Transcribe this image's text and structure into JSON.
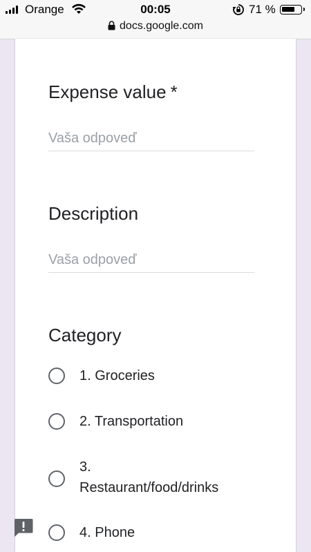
{
  "status_bar": {
    "carrier": "Orange",
    "time": "00:05",
    "battery": "71 %",
    "battery_level": 0.71,
    "url": "docs.google.com"
  },
  "form": {
    "questions": [
      {
        "title": "Expense value",
        "required_mark": "*",
        "placeholder": "Vaša odpoveď"
      },
      {
        "title": "Description",
        "placeholder": "Vaša odpoveď"
      },
      {
        "title": "Category",
        "options": [
          "1. Groceries",
          "2. Transportation",
          "3.",
          "Restaurant/food/drinks",
          "4. Phone"
        ]
      }
    ]
  },
  "icons": {
    "feedback": "feedback-icon",
    "lock": "lock-icon",
    "wifi": "wifi-icon",
    "signal": "signal-icon"
  }
}
